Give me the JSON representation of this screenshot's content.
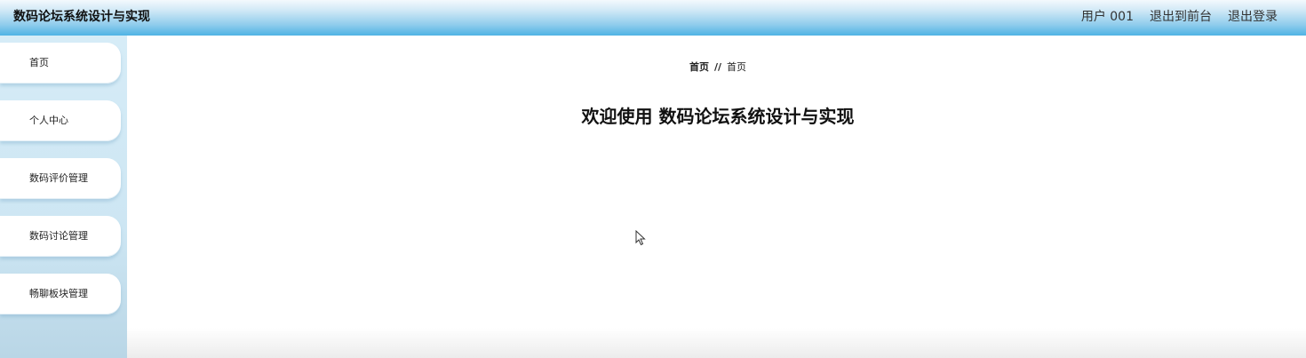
{
  "header": {
    "title": "数码论坛系统设计与实现",
    "user_label": "用户 001",
    "back_to_front_label": "退出到前台",
    "logout_label": "退出登录"
  },
  "sidebar": {
    "items": [
      {
        "label": "首页"
      },
      {
        "label": "个人中心"
      },
      {
        "label": "数码评价管理"
      },
      {
        "label": "数码讨论管理"
      },
      {
        "label": "畅聊板块管理"
      }
    ]
  },
  "breadcrumb": {
    "home": "首页",
    "separator": "//",
    "current": "首页"
  },
  "main": {
    "welcome": "欢迎使用 数码论坛系统设计与实现"
  },
  "icons": {
    "cursor": "mouse-pointer-icon"
  },
  "colors": {
    "header_accent": "#4fb3e4",
    "sidebar_bg": "#d6ecf7"
  }
}
